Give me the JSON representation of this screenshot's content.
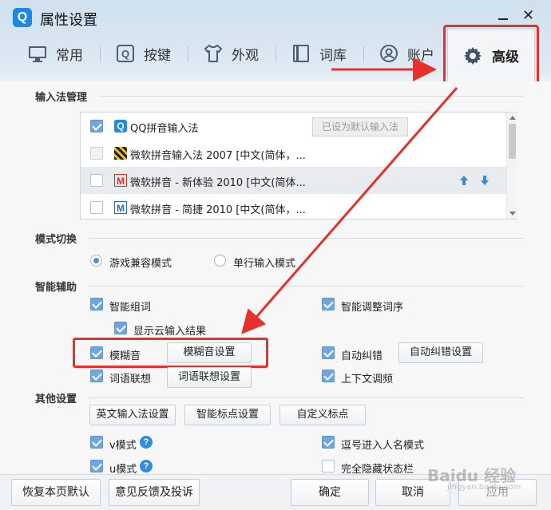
{
  "window": {
    "title": "属性设置",
    "logo_letter": "Q"
  },
  "tabs": [
    {
      "label": "常用",
      "icon": "monitor-icon"
    },
    {
      "label": "按键",
      "icon": "q-key-icon"
    },
    {
      "label": "外观",
      "icon": "tshirt-icon"
    },
    {
      "label": "词库",
      "icon": "book-icon"
    },
    {
      "label": "账户",
      "icon": "user-icon"
    },
    {
      "label": "高级",
      "icon": "gear-icon",
      "active": true
    }
  ],
  "ime_section": {
    "title": "输入法管理",
    "items": [
      {
        "name": "QQ拼音输入法",
        "checked": true,
        "logo": "Q"
      },
      {
        "name": "微软拼音输入法 2007 [中文(简体，...",
        "checked": false,
        "logo": ""
      },
      {
        "name": "微软拼音 - 新体验 2010 [中文(简体...",
        "checked": false,
        "logo": "M"
      },
      {
        "name": "微软拼音 - 简捷 2010 [中文(简体，...",
        "checked": false,
        "logo": "M"
      }
    ],
    "default_button": "已设为默认输入法"
  },
  "mode_section": {
    "title": "模式切换",
    "options": [
      {
        "label": "游戏兼容模式",
        "selected": true
      },
      {
        "label": "单行输入模式",
        "selected": false
      }
    ]
  },
  "smart_section": {
    "title": "智能辅助",
    "smart_compose": "智能组词",
    "show_cloud": "显示云输入结果",
    "fuzzy": "模糊音",
    "fuzzy_settings": "模糊音设置",
    "association": "词语联想",
    "association_settings": "词语联想设置",
    "smart_adjust": "智能调整词序",
    "auto_correct": "自动纠错",
    "auto_correct_settings": "自动纠错设置",
    "context_adjust": "上下文调频"
  },
  "other_section": {
    "title": "其他设置",
    "english_ime_settings": "英文输入法设置",
    "smart_punct_settings": "智能标点设置",
    "custom_punct": "自定义标点",
    "v_mode": "v模式",
    "u_mode": "u模式",
    "comma_name_mode": "逗号进入人名模式",
    "hide_status_bar": "完全隐藏状态栏"
  },
  "bottom": {
    "restore": "恢复本页默认",
    "feedback": "意见反馈及投诉",
    "ok": "确定",
    "cancel": "取消",
    "apply": "应用"
  },
  "watermark": {
    "brand": "Baidu 经验",
    "sub": "jingyan.baidu.com"
  },
  "colors": {
    "accent": "#6ea6df",
    "annotation": "#e8302a",
    "help": "#2f8de0"
  }
}
